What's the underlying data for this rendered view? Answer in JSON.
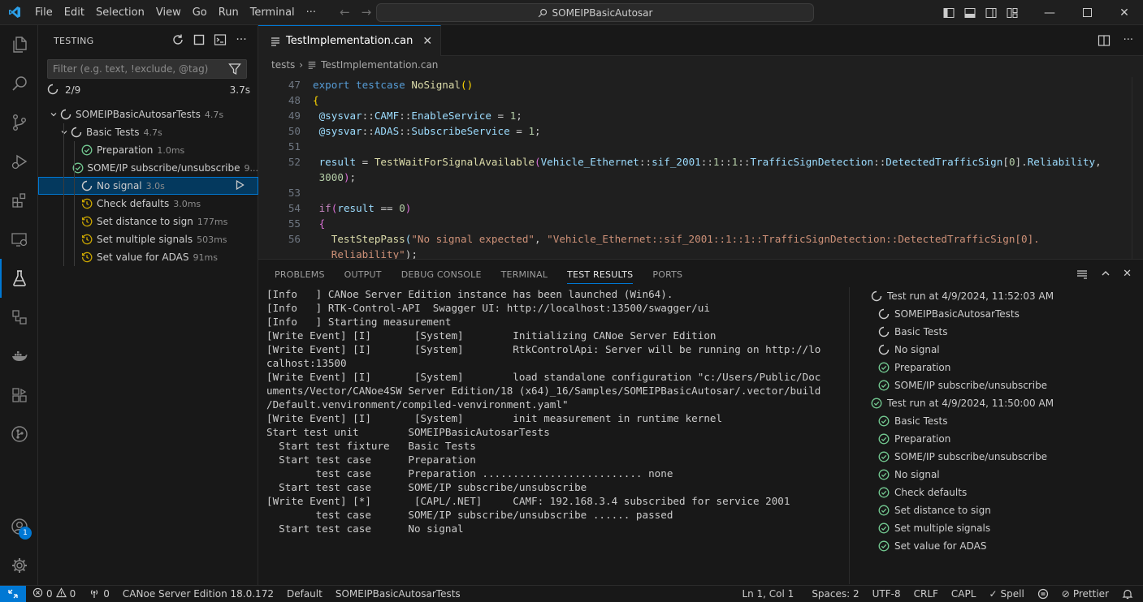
{
  "menu": [
    "File",
    "Edit",
    "Selection",
    "View",
    "Go",
    "Run",
    "Terminal",
    "···"
  ],
  "search": {
    "label": "SOMEIPBasicAutosar"
  },
  "sidebar": {
    "title": "TESTING",
    "filter_placeholder": "Filter (e.g. text, !exclude, @tag)",
    "summary_count": "2/9",
    "summary_time": "3.7s",
    "tree": [
      {
        "label": "SOMEIPBasicAutosarTests",
        "dur": "4.7s",
        "status": "running",
        "level": 0,
        "chev": "v"
      },
      {
        "label": "Basic Tests",
        "dur": "4.7s",
        "status": "running",
        "level": 1,
        "chev": "v"
      },
      {
        "label": "Preparation",
        "dur": "1.0ms",
        "status": "passed",
        "level": 2
      },
      {
        "label": "SOME/IP subscribe/unsubscribe",
        "dur": "9...",
        "status": "passed",
        "level": 2
      },
      {
        "label": "No signal",
        "dur": "3.0s",
        "status": "running",
        "level": 2,
        "selected": true
      },
      {
        "label": "Check defaults",
        "dur": "3.0ms",
        "status": "queued",
        "level": 2
      },
      {
        "label": "Set distance to sign",
        "dur": "177ms",
        "status": "queued",
        "level": 2
      },
      {
        "label": "Set multiple signals",
        "dur": "503ms",
        "status": "queued",
        "level": 2
      },
      {
        "label": "Set value for ADAS",
        "dur": "91ms",
        "status": "queued",
        "level": 2
      }
    ]
  },
  "editor": {
    "tab": "TestImplementation.can",
    "breadcrumb": [
      "tests",
      "TestImplementation.can"
    ],
    "lines": [
      "47",
      "48",
      "49",
      "50",
      "51",
      "52",
      "",
      "53",
      "54",
      "55",
      "56",
      ""
    ]
  },
  "panel": {
    "tabs": [
      "PROBLEMS",
      "OUTPUT",
      "DEBUG CONSOLE",
      "TERMINAL",
      "TEST RESULTS",
      "PORTS"
    ],
    "active_tab": "TEST RESULTS",
    "output": [
      "[Info   ] CANoe Server Edition instance has been launched (Win64).",
      "[Info   ] RTK-Control-API  Swagger UI: http://localhost:13500/swagger/ui",
      "[Info   ] Starting measurement",
      "[Write Event] [I]       [System]        Initializing CANoe Server Edition",
      "[Write Event] [I]       [System]        RtkControlApi: Server will be running on http://lo",
      "calhost:13500",
      "[Write Event] [I]       [System]        load standalone configuration \"c:/Users/Public/Doc",
      "uments/Vector/CANoe4SW Server Edition/18 (x64)_16/Samples/SOMEIPBasicAutosar/.vector/build",
      "/Default.venvironment/compiled-venvironment.yaml\"",
      "[Write Event] [I]       [System]        init measurement in runtime kernel",
      "Start test unit        SOMEIPBasicAutosarTests",
      "  Start test fixture   Basic Tests",
      "  Start test case      Preparation",
      "        test case      Preparation .......................... none",
      "  Start test case      SOME/IP subscribe/unsubscribe",
      "[Write Event] [*]       [CAPL/.NET]     CAMF: 192.168.3.4 subscribed for service 2001",
      "        test case      SOME/IP subscribe/unsubscribe ...... passed",
      "  Start test case      No signal"
    ],
    "results": [
      {
        "label": "Test run at 4/9/2024, 11:52:03 AM",
        "status": "running",
        "indent": 0
      },
      {
        "label": "SOMEIPBasicAutosarTests",
        "status": "running",
        "indent": 1
      },
      {
        "label": "Basic Tests",
        "status": "running",
        "indent": 1
      },
      {
        "label": "No signal",
        "status": "running",
        "indent": 1
      },
      {
        "label": "Preparation",
        "status": "passed",
        "indent": 1
      },
      {
        "label": "SOME/IP subscribe/unsubscribe",
        "status": "passed",
        "indent": 1
      },
      {
        "label": "Test run at 4/9/2024, 11:50:00 AM",
        "status": "passed",
        "indent": 0
      },
      {
        "label": "Basic Tests",
        "status": "passed",
        "indent": 1
      },
      {
        "label": "Preparation",
        "status": "passed",
        "indent": 1
      },
      {
        "label": "SOME/IP subscribe/unsubscribe",
        "status": "passed",
        "indent": 1
      },
      {
        "label": "No signal",
        "status": "passed",
        "indent": 1
      },
      {
        "label": "Check defaults",
        "status": "passed",
        "indent": 1
      },
      {
        "label": "Set distance to sign",
        "status": "passed",
        "indent": 1
      },
      {
        "label": "Set multiple signals",
        "status": "passed",
        "indent": 1
      },
      {
        "label": "Set value for ADAS",
        "status": "passed",
        "indent": 1
      }
    ]
  },
  "status": {
    "errors": "0",
    "warnings": "0",
    "ports": "0",
    "product": "CANoe Server Edition 18.0.172",
    "config": "Default",
    "test_unit": "SOMEIPBasicAutosarTests",
    "position": "Ln 1, Col 1",
    "spaces": "Spaces: 2",
    "encoding": "UTF-8",
    "eol": "CRLF",
    "language": "CAPL",
    "spell": "Spell",
    "prettier": "Prettier"
  },
  "notifications_badge": "1",
  "colors": {
    "accent": "#0078d4",
    "passed": "#73c991",
    "queued": "#cca700"
  }
}
